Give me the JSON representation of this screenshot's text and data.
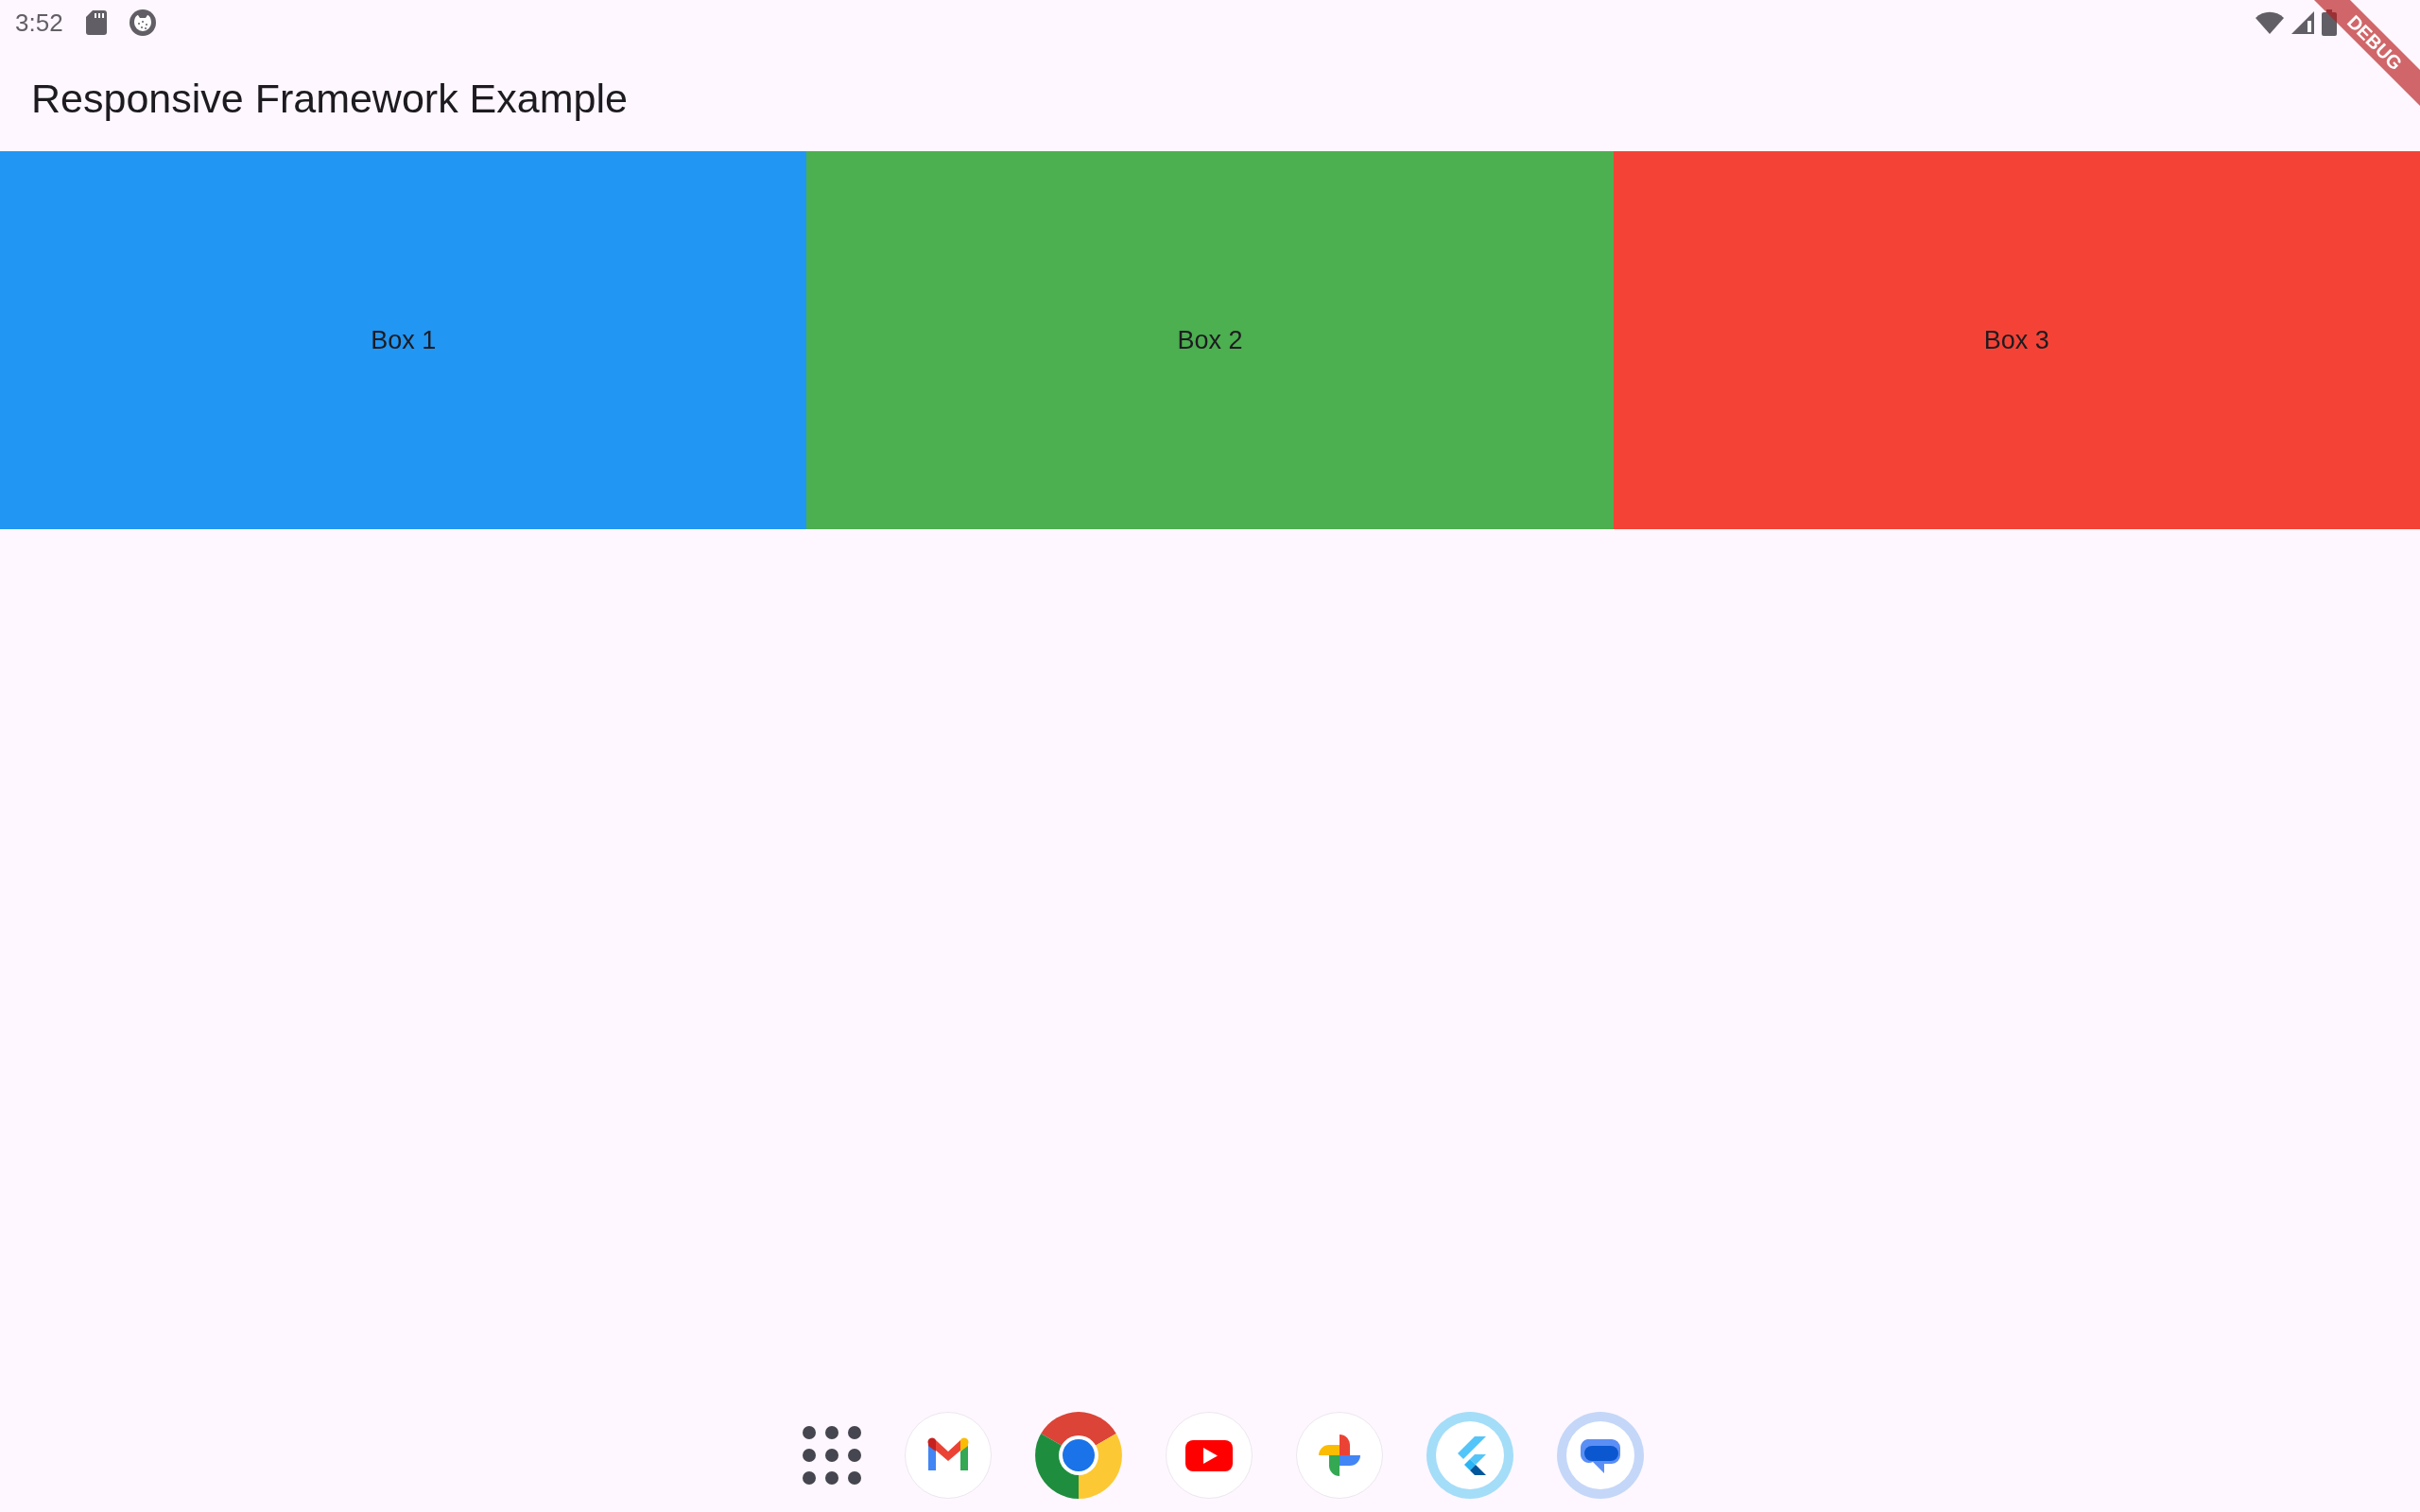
{
  "status_bar": {
    "time": "3:52"
  },
  "app_bar": {
    "title": "Responsive Framework Example"
  },
  "boxes": [
    {
      "label": "Box 1",
      "color": "#2196f3"
    },
    {
      "label": "Box 2",
      "color": "#4caf50"
    },
    {
      "label": "Box 3",
      "color": "#f44336"
    }
  ],
  "debug_banner": {
    "label": "DEBUG"
  }
}
